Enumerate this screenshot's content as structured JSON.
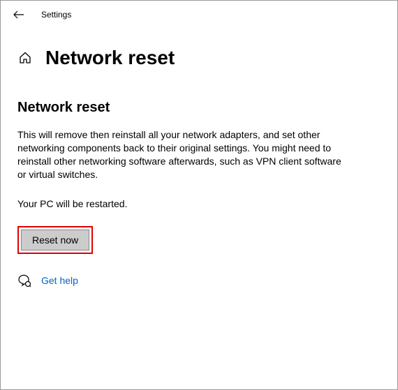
{
  "titlebar": {
    "title": "Settings"
  },
  "header": {
    "page_title": "Network reset"
  },
  "content": {
    "section_title": "Network reset",
    "description": "This will remove then reinstall all your network adapters, and set other networking components back to their original settings. You might need to reinstall other networking software afterwards, such as VPN client software or virtual switches.",
    "restart_note": "Your PC will be restarted.",
    "reset_button_label": "Reset now",
    "help_link_label": "Get help"
  }
}
